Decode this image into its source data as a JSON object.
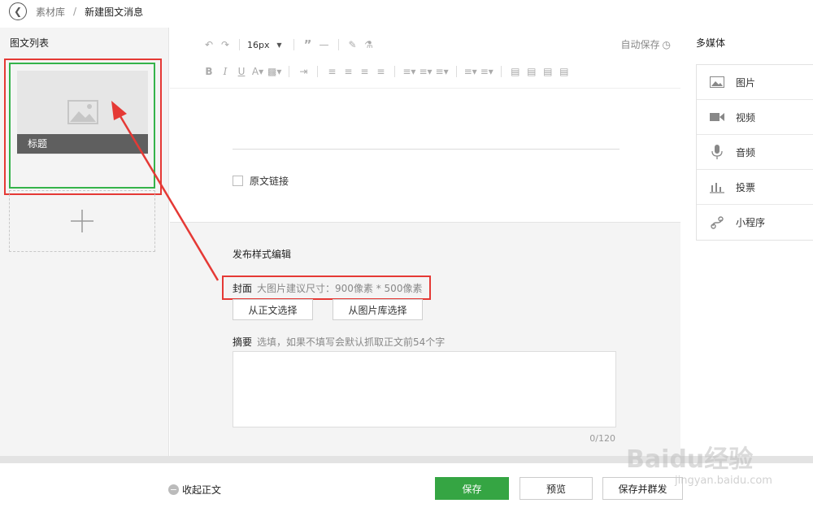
{
  "breadcrumb": {
    "parent": "素材库",
    "separator": "/",
    "current": "新建图文消息"
  },
  "left_panel": {
    "title": "图文列表",
    "card_title": "标题",
    "add_icon": "plus-icon"
  },
  "toolbar": {
    "font_size": "16px",
    "autosave_label": "自动保存"
  },
  "editor": {
    "original_link_label": "原文链接"
  },
  "publish": {
    "section_title": "发布样式编辑",
    "cover_label": "封面",
    "cover_hint": "大图片建议尺寸：900像素 * 500像素",
    "select_from_body": "从正文选择",
    "select_from_library": "从图片库选择",
    "abstract_label": "摘要",
    "abstract_hint": "选填，如果不填写会默认抓取正文前54个字",
    "abstract_counter": "0/120"
  },
  "media_panel": {
    "title": "多媒体",
    "items": [
      {
        "label": "图片",
        "icon": "image-icon"
      },
      {
        "label": "视频",
        "icon": "video-icon"
      },
      {
        "label": "音频",
        "icon": "microphone-icon"
      },
      {
        "label": "投票",
        "icon": "bar-chart-icon"
      },
      {
        "label": "小程序",
        "icon": "mini-program-icon"
      }
    ]
  },
  "bottom_bar": {
    "collapse_label": "收起正文",
    "save_label": "保存",
    "preview_label": "预览",
    "save_and_send_label": "保存并群发"
  },
  "watermark": {
    "brand": "Baidu经验",
    "url": "jingyan.baidu.com"
  },
  "colors": {
    "primary_green": "#35a543",
    "annotation_red": "#e53935",
    "selection_green": "#34b34a"
  }
}
